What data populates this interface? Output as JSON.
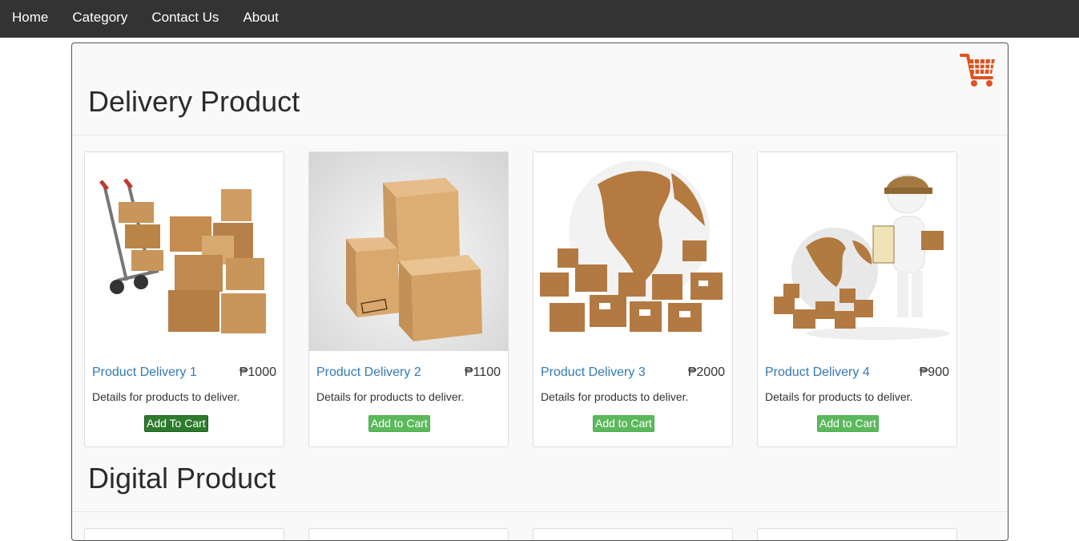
{
  "nav": {
    "items": [
      "Home",
      "Category",
      "Contact Us",
      "About"
    ]
  },
  "sections": {
    "delivery": {
      "title": "Delivery Product",
      "products": [
        {
          "name": "Product Delivery 1",
          "price": "₱1000",
          "description": "Details for products to deliver.",
          "button": "Add To Cart"
        },
        {
          "name": "Product Delivery 2",
          "price": "₱1100",
          "description": "Details for products to deliver.",
          "button": "Add to Cart"
        },
        {
          "name": "Product Delivery 3",
          "price": "₱2000",
          "description": "Details for products to deliver.",
          "button": "Add to Cart"
        },
        {
          "name": "Product Delivery 4",
          "price": "₱900",
          "description": "Details for products to deliver.",
          "button": "Add to Cart"
        }
      ]
    },
    "digital": {
      "title": "Digital Product"
    }
  },
  "colors": {
    "navbar": "#333333",
    "link": "#337ab7",
    "button": "#5cb85c",
    "button_active": "#2d7a2d",
    "cart_icon": "#e0521f"
  },
  "icons": {
    "cart": "shopping-cart-icon"
  }
}
